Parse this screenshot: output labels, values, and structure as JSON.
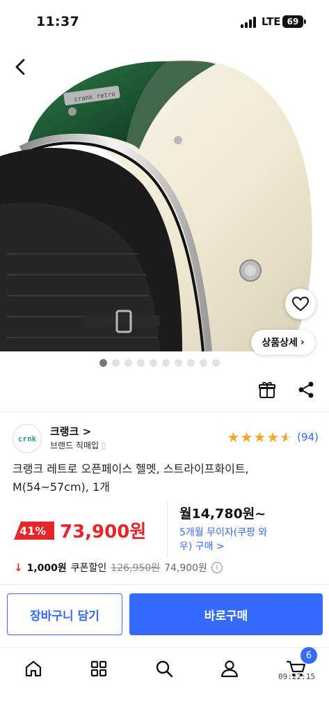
{
  "status_bar": {
    "time": "11:37",
    "network": "LTE",
    "battery": "69"
  },
  "hero": {
    "detail_chip": "상품상세",
    "image_count": 10,
    "active_index": 0,
    "helmet_text": "crank retro"
  },
  "seller": {
    "logo_text": "crnk",
    "name": "크랭크",
    "name_arrow": ">",
    "subtitle": "브랜드 직매입"
  },
  "rating": {
    "stars": 4.5,
    "review_count": "(94)"
  },
  "product": {
    "title": "크랭크 레트로 오픈페이스 헬멧, 스트라이프화이트, M(54~57cm), 1개"
  },
  "price": {
    "discount": "41%",
    "sale_price": "73,900원",
    "monthly": "월14,780원~",
    "installment": "5개월 무이자(쿠팡 와우) 구매 >"
  },
  "coupon": {
    "amount": "1,000원",
    "label": "쿠폰할인",
    "original": "126,950원",
    "final": "74,900원",
    "info": "i"
  },
  "actions": {
    "cart_label": "장바구니 담기",
    "buy_label": "바로구매"
  },
  "tabbar": {
    "cart_count": "6",
    "clock": "09:22:15"
  },
  "colors": {
    "accent": "#346aff",
    "sale": "#e52528",
    "star": "#f5a623",
    "helmet_green": "#1e5e35",
    "helmet_cream": "#f2ecd8"
  }
}
